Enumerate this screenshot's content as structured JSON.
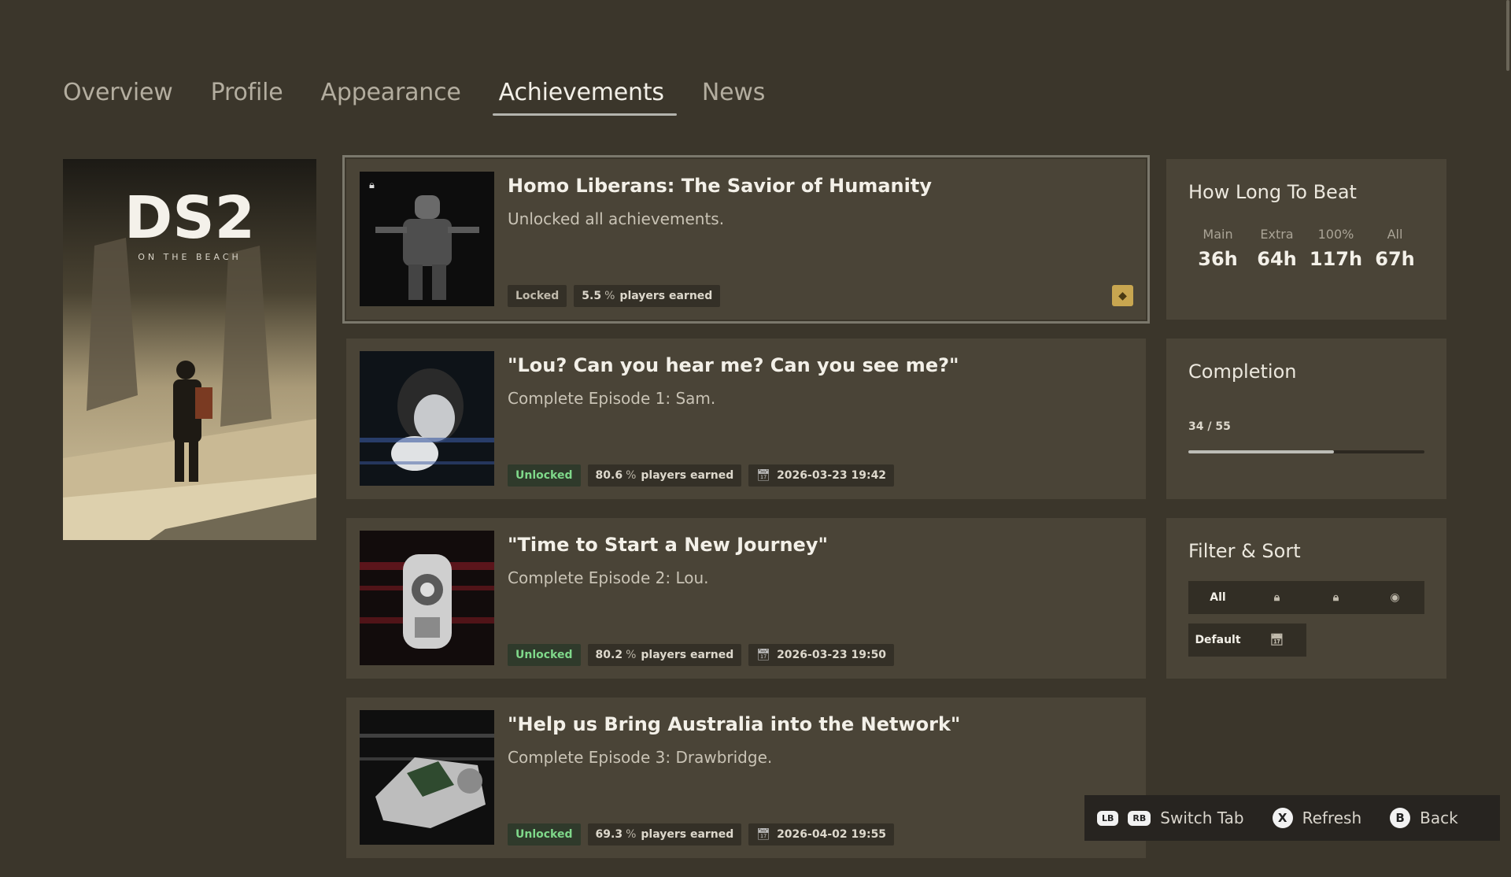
{
  "tabs": [
    {
      "label": "Overview"
    },
    {
      "label": "Profile"
    },
    {
      "label": "Appearance"
    },
    {
      "label": "Achievements",
      "active": true
    },
    {
      "label": "News"
    }
  ],
  "cover": {
    "logo": "DS2",
    "sublogo": "ON THE BEACH"
  },
  "achievements": [
    {
      "title": "Homo Liberans: The Savior of Humanity",
      "description": "Unlocked all achievements.",
      "status": "Locked",
      "percent": "5.5",
      "percent_symbol": "%",
      "players_label": "players earned",
      "date": "",
      "rarity_icon": "gem-icon"
    },
    {
      "title": "\"Lou? Can you hear me? Can you see me?\"",
      "description": "Complete Episode 1: Sam.",
      "status": "Unlocked",
      "percent": "80.6",
      "percent_symbol": "%",
      "players_label": "players earned",
      "date": "2026-03-23 19:42"
    },
    {
      "title": "\"Time to Start a New Journey\"",
      "description": "Complete Episode 2: Lou.",
      "status": "Unlocked",
      "percent": "80.2",
      "percent_symbol": "%",
      "players_label": "players earned",
      "date": "2026-03-23 19:50"
    },
    {
      "title": "\"Help us Bring Australia into the Network\"",
      "description": "Complete Episode 3: Drawbridge.",
      "status": "Unlocked",
      "percent": "69.3",
      "percent_symbol": "%",
      "players_label": "players earned",
      "date": "2026-04-02 19:55"
    }
  ],
  "hltb": {
    "title": "How Long To Beat",
    "columns": [
      {
        "label": "Main",
        "value": "36h"
      },
      {
        "label": "Extra",
        "value": "64h"
      },
      {
        "label": "100%",
        "value": "117h"
      },
      {
        "label": "All",
        "value": "67h"
      }
    ]
  },
  "completion": {
    "title": "Completion",
    "text": "34 / 55",
    "unlocked": 34,
    "total": 55
  },
  "filter": {
    "title": "Filter & Sort",
    "filters": [
      "All",
      "lock-icon",
      "lock-icon",
      "eye-off-icon"
    ],
    "all_label": "All",
    "sort_label": "Default",
    "sort_icon": "calendar-sort-icon"
  },
  "hints": {
    "lb": "LB",
    "rb": "RB",
    "switch_tab": "Switch Tab",
    "x": "X",
    "refresh": "Refresh",
    "b": "B",
    "back": "Back"
  },
  "colors": {
    "background": "#3b362b",
    "card": "#4a4437",
    "unlocked_green": "#7fd88a",
    "gem_gold": "#c8a650"
  }
}
